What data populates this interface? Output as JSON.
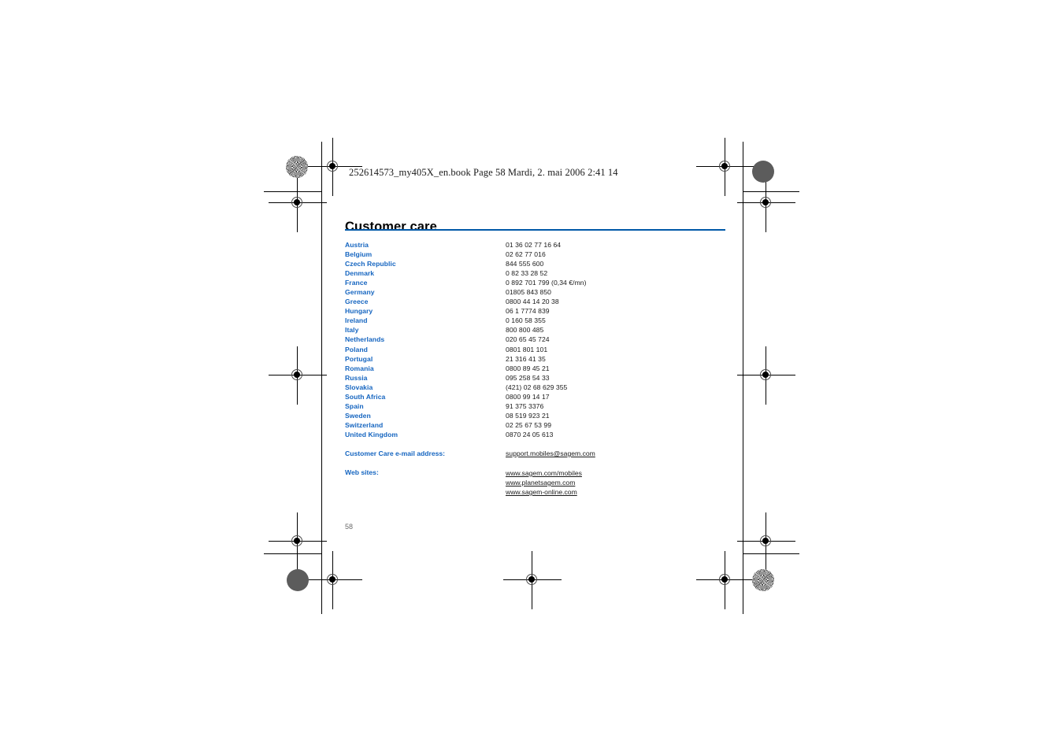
{
  "proof": {
    "file_header": "252614573_my405X_en.book  Page 58  Mardi, 2. mai 2006  2:41 14",
    "registration_mark_name": "registration-target",
    "density_patch_name": "density-patch"
  },
  "page": {
    "title": "Customer care",
    "page_number": "58",
    "rule_color": "#0059a8",
    "country_color": "#1565c0",
    "text_color": "#1a1a1a"
  },
  "contacts": [
    {
      "country": "Austria",
      "phone": "01 36 02 77 16 64"
    },
    {
      "country": "Belgium",
      "phone": "02 62 77 016"
    },
    {
      "country": "Czech Republic",
      "phone": "844 555 600"
    },
    {
      "country": "Denmark",
      "phone": "0 82 33 28 52"
    },
    {
      "country": "France",
      "phone": "0 892 701 799 (0,34 €/mn)"
    },
    {
      "country": "Germany",
      "phone": "01805 843 850"
    },
    {
      "country": "Greece",
      "phone": "0800 44 14 20 38"
    },
    {
      "country": "Hungary",
      "phone": "06 1 7774 839"
    },
    {
      "country": "Ireland",
      "phone": "0 160 58 355"
    },
    {
      "country": "Italy",
      "phone": "800 800 485"
    },
    {
      "country": "Netherlands",
      "phone": "020 65 45 724"
    },
    {
      "country": "Poland",
      "phone": "0801 801 101"
    },
    {
      "country": "Portugal",
      "phone": "21 316 41 35"
    },
    {
      "country": "Romania",
      "phone": "0800 89 45 21"
    },
    {
      "country": "Russia",
      "phone": "095 258 54 33"
    },
    {
      "country": "Slovakia",
      "phone": "(421) 02 68 629 355"
    },
    {
      "country": "South Africa",
      "phone": "0800 99 14 17"
    },
    {
      "country": "Spain",
      "phone": "91 375 3376"
    },
    {
      "country": "Sweden",
      "phone": "08 519 923 21"
    },
    {
      "country": "Switzerland",
      "phone": "02 25 67 53 99"
    },
    {
      "country": "United Kingdom",
      "phone": "0870 24 05 613"
    }
  ],
  "email": {
    "label": "Customer Care e-mail address:",
    "value": "support.mobiles@sagem.com"
  },
  "websites": {
    "label": "Web sites:",
    "items": [
      "www.sagem.com/mobiles",
      "www.planetsagem.com",
      "www.sagem-online.com"
    ]
  }
}
